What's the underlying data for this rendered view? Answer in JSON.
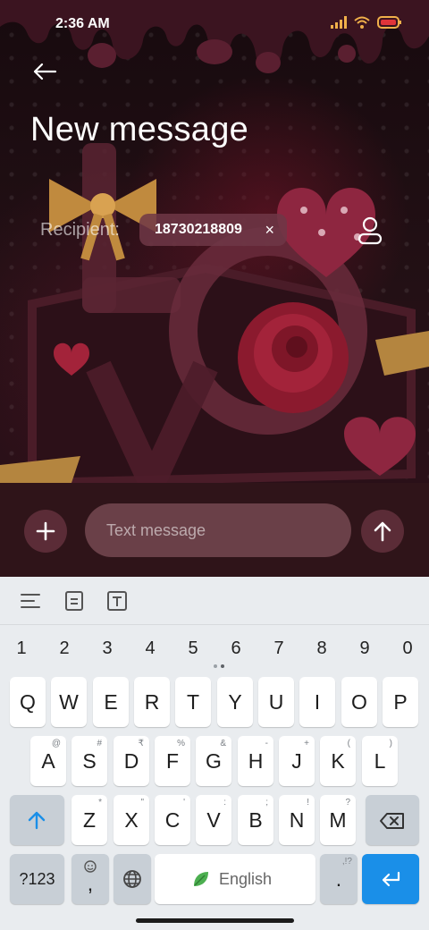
{
  "status_bar": {
    "time": "2:36 AM",
    "icons": [
      "signal-icon",
      "wifi-icon",
      "battery-icon"
    ]
  },
  "header": {
    "title": "New message"
  },
  "recipient": {
    "label": "Recipient:",
    "number": "18730218809",
    "remove_symbol": "×"
  },
  "composer": {
    "placeholder": "Text message"
  },
  "keyboard": {
    "toolbar": [
      "menu-icon",
      "clipboard-icon",
      "text-style-icon"
    ],
    "numbers": [
      "1",
      "2",
      "3",
      "4",
      "5",
      "6",
      "7",
      "8",
      "9",
      "0"
    ],
    "row1": [
      {
        "k": "Q",
        "s": ""
      },
      {
        "k": "W",
        "s": ""
      },
      {
        "k": "E",
        "s": ""
      },
      {
        "k": "R",
        "s": ""
      },
      {
        "k": "T",
        "s": ""
      },
      {
        "k": "Y",
        "s": ""
      },
      {
        "k": "U",
        "s": ""
      },
      {
        "k": "I",
        "s": ""
      },
      {
        "k": "O",
        "s": ""
      },
      {
        "k": "P",
        "s": ""
      }
    ],
    "row2": [
      {
        "k": "A",
        "s": "@"
      },
      {
        "k": "S",
        "s": "#"
      },
      {
        "k": "D",
        "s": "₹"
      },
      {
        "k": "F",
        "s": "%"
      },
      {
        "k": "G",
        "s": "&"
      },
      {
        "k": "H",
        "s": "-"
      },
      {
        "k": "J",
        "s": "+"
      },
      {
        "k": "K",
        "s": "("
      },
      {
        "k": "L",
        "s": ")"
      }
    ],
    "row3": [
      {
        "k": "Z",
        "s": "*"
      },
      {
        "k": "X",
        "s": "\""
      },
      {
        "k": "C",
        "s": "'"
      },
      {
        "k": "V",
        "s": ":"
      },
      {
        "k": "B",
        "s": ";"
      },
      {
        "k": "N",
        "s": "!"
      },
      {
        "k": "M",
        "s": "?"
      }
    ],
    "symbols_key": "?123",
    "comma_key": ",",
    "space_label": "English",
    "period_key": ".",
    "period_sub": ",!?",
    "accent_color": "#1a8fe8"
  }
}
